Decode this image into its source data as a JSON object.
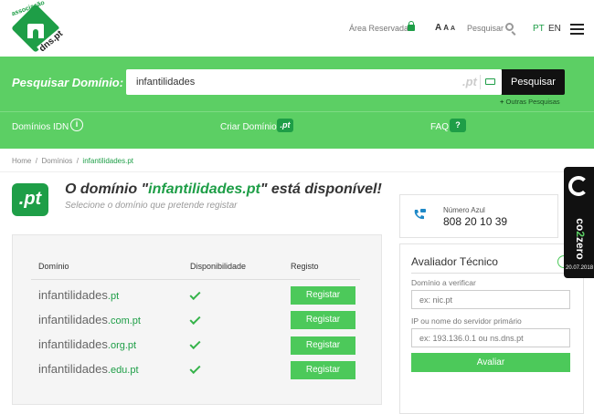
{
  "header": {
    "logo_top": "associação",
    "logo_bottom": "dns.pt",
    "area_reservada": "Área Reservada",
    "font_sizes": [
      "A",
      "A",
      "A"
    ],
    "search_link": "Pesquisar",
    "lang_pt": "PT",
    "lang_en": "EN"
  },
  "search": {
    "label": "Pesquisar Domínio:",
    "value": "infantilidades",
    "suffix": ".pt",
    "button": "Pesquisar",
    "more": "Outras Pesquisas"
  },
  "nav": {
    "idn": "Domínios IDN",
    "criar": "Criar Domínio",
    "criar_badge": ".pt",
    "faq": "FAQ",
    "faq_badge": "?"
  },
  "breadcrumb": {
    "home": "Home",
    "sep": "/",
    "dominios": "Domínios",
    "current": "infantilidades.pt"
  },
  "result": {
    "badge": ".pt",
    "headline_pre": "O domínio \"",
    "headline_domain": "infantilidades.pt",
    "headline_post": "\" está disponível!",
    "subtitle": "Selecione o domínio que pretende registar"
  },
  "table": {
    "headers": {
      "domain": "Domínio",
      "availability": "Disponibilidade",
      "register": "Registo"
    },
    "rows": [
      {
        "name": "infantilidades",
        "tld": ".pt",
        "button": "Registar"
      },
      {
        "name": "infantilidades",
        "tld": ".com.pt",
        "button": "Registar"
      },
      {
        "name": "infantilidades",
        "tld": ".org.pt",
        "button": "Registar"
      },
      {
        "name": "infantilidades",
        "tld": ".edu.pt",
        "button": "Registar"
      }
    ]
  },
  "contact": {
    "label": "Número Azul",
    "number": "808 20 10 39"
  },
  "avaliador": {
    "title": "Avaliador Técnico",
    "domain_label": "Domínio a verificar",
    "domain_placeholder": "ex: nic.pt",
    "server_label": "IP ou nome do servidor primário",
    "server_placeholder": "ex: 193.136.0.1 ou ns.dns.pt",
    "button": "Avaliar"
  },
  "co2": {
    "text_1": "co",
    "text_2": "2",
    "text_3": "zero",
    "date": "20.07.2018"
  },
  "colors": {
    "brand_green": "#1e9e47",
    "band_green": "#5ccf64",
    "button_green": "#4cc95a",
    "dark": "#111111"
  }
}
